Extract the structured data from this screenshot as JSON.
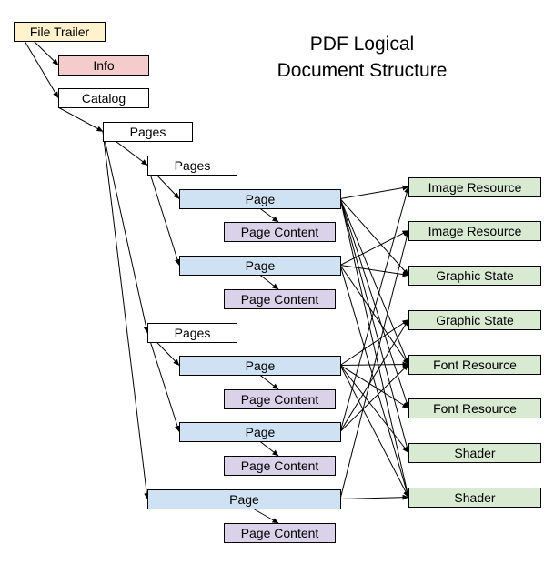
{
  "title": {
    "line1": "PDF Logical",
    "line2": "Document Structure"
  },
  "colors": {
    "trailer": "#fff2cc",
    "info": "#f4cccc",
    "plain": "#ffffff",
    "page": "#cfe2f3",
    "content": "#d9d2e9",
    "resource": "#d9ead3",
    "stroke": "#000000"
  },
  "nodes": [
    {
      "id": "trailer",
      "label": "File Trailer",
      "kind": "trailer"
    },
    {
      "id": "info",
      "label": "Info",
      "kind": "info"
    },
    {
      "id": "catalog",
      "label": "Catalog",
      "kind": "plain"
    },
    {
      "id": "pages_root",
      "label": "Pages",
      "kind": "plain"
    },
    {
      "id": "pages_a",
      "label": "Pages",
      "kind": "plain"
    },
    {
      "id": "page1",
      "label": "Page",
      "kind": "page"
    },
    {
      "id": "content1",
      "label": "Page Content",
      "kind": "content"
    },
    {
      "id": "page2",
      "label": "Page",
      "kind": "page"
    },
    {
      "id": "content2",
      "label": "Page Content",
      "kind": "content"
    },
    {
      "id": "pages_b",
      "label": "Pages",
      "kind": "plain"
    },
    {
      "id": "page3",
      "label": "Page",
      "kind": "page"
    },
    {
      "id": "content3",
      "label": "Page Content",
      "kind": "content"
    },
    {
      "id": "page4",
      "label": "Page",
      "kind": "page"
    },
    {
      "id": "content4",
      "label": "Page Content",
      "kind": "content"
    },
    {
      "id": "page5",
      "label": "Page",
      "kind": "page"
    },
    {
      "id": "content5",
      "label": "Page Content",
      "kind": "content"
    },
    {
      "id": "img1",
      "label": "Image Resource",
      "kind": "resource"
    },
    {
      "id": "img2",
      "label": "Image Resource",
      "kind": "resource"
    },
    {
      "id": "gs1",
      "label": "Graphic State",
      "kind": "resource"
    },
    {
      "id": "gs2",
      "label": "Graphic State",
      "kind": "resource"
    },
    {
      "id": "font1",
      "label": "Font Resource",
      "kind": "resource"
    },
    {
      "id": "font2",
      "label": "Font Resource",
      "kind": "resource"
    },
    {
      "id": "shader1",
      "label": "Shader",
      "kind": "resource"
    },
    {
      "id": "shader2",
      "label": "Shader",
      "kind": "resource"
    }
  ],
  "edges": [
    {
      "from": "trailer",
      "to": "info"
    },
    {
      "from": "trailer",
      "to": "catalog"
    },
    {
      "from": "catalog",
      "to": "pages_root"
    },
    {
      "from": "pages_root",
      "to": "pages_a"
    },
    {
      "from": "pages_root",
      "to": "pages_b"
    },
    {
      "from": "pages_root",
      "to": "page5"
    },
    {
      "from": "pages_a",
      "to": "page1"
    },
    {
      "from": "pages_a",
      "to": "page2"
    },
    {
      "from": "pages_b",
      "to": "page3"
    },
    {
      "from": "pages_b",
      "to": "page4"
    },
    {
      "from": "page1",
      "to": "content1"
    },
    {
      "from": "page2",
      "to": "content2"
    },
    {
      "from": "page3",
      "to": "content3"
    },
    {
      "from": "page4",
      "to": "content4"
    },
    {
      "from": "page5",
      "to": "content5"
    },
    {
      "from": "page1",
      "to": "img1"
    },
    {
      "from": "page1",
      "to": "gs1"
    },
    {
      "from": "page1",
      "to": "font1"
    },
    {
      "from": "page1",
      "to": "font2"
    },
    {
      "from": "page1",
      "to": "shader1"
    },
    {
      "from": "page1",
      "to": "shader2"
    },
    {
      "from": "page2",
      "to": "img2"
    },
    {
      "from": "page2",
      "to": "gs1"
    },
    {
      "from": "page2",
      "to": "font1"
    },
    {
      "from": "page2",
      "to": "shader2"
    },
    {
      "from": "page3",
      "to": "gs2"
    },
    {
      "from": "page3",
      "to": "font1"
    },
    {
      "from": "page3",
      "to": "font2"
    },
    {
      "from": "page3",
      "to": "shader1"
    },
    {
      "from": "page3",
      "to": "shader2"
    },
    {
      "from": "page4",
      "to": "img1"
    },
    {
      "from": "page4",
      "to": "gs2"
    },
    {
      "from": "page4",
      "to": "font1"
    },
    {
      "from": "page5",
      "to": "img2"
    },
    {
      "from": "page5",
      "to": "shader2"
    }
  ]
}
